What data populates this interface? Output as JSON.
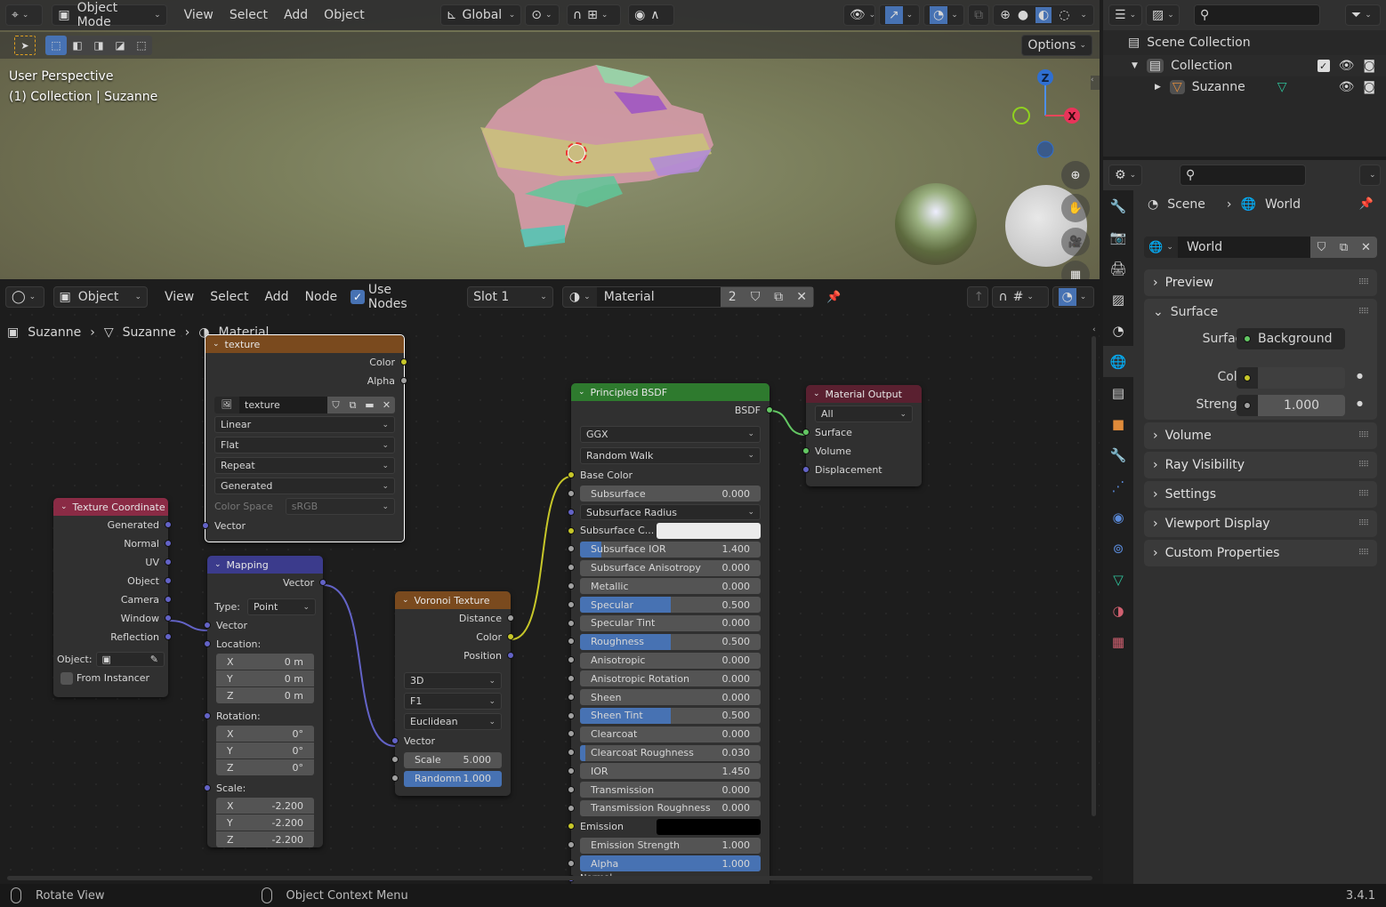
{
  "viewport": {
    "header": {
      "editor_icon": "editor-type-3d-icon",
      "mode": "Object Mode",
      "menus": [
        "View",
        "Select",
        "Add",
        "Object"
      ],
      "orientation": "Global",
      "options_label": "Options"
    },
    "overlay_text": {
      "line1": "User Perspective",
      "line2": "(1) Collection | Suzanne"
    },
    "gizmo": {
      "z": "Z",
      "x": "X"
    }
  },
  "node_editor": {
    "header": {
      "mode": "Object",
      "menus": [
        "View",
        "Select",
        "Add",
        "Node"
      ],
      "use_nodes_label": "Use Nodes",
      "use_nodes_checked": true,
      "slot": "Slot 1",
      "material_name": "Material",
      "user_count": "2"
    },
    "breadcrumb": [
      "Suzanne",
      "Suzanne",
      "Material"
    ],
    "nodes": {
      "image_texture": {
        "title": "texture",
        "outputs": [
          "Color",
          "Alpha"
        ],
        "image_name": "texture",
        "interpolation": "Linear",
        "projection": "Flat",
        "extension": "Repeat",
        "source": "Generated",
        "color_space_label": "Color Space",
        "color_space": "sRGB",
        "input": "Vector"
      },
      "texture_coordinate": {
        "title": "Texture Coordinate",
        "outputs": [
          "Generated",
          "Normal",
          "UV",
          "Object",
          "Camera",
          "Window",
          "Reflection"
        ],
        "object_label": "Object:",
        "from_instancer": "From Instancer"
      },
      "mapping": {
        "title": "Mapping",
        "output": "Vector",
        "type_label": "Type:",
        "type": "Point",
        "input_vector": "Vector",
        "location_label": "Location:",
        "location": [
          {
            "axis": "X",
            "value": "0 m"
          },
          {
            "axis": "Y",
            "value": "0 m"
          },
          {
            "axis": "Z",
            "value": "0 m"
          }
        ],
        "rotation_label": "Rotation:",
        "rotation": [
          {
            "axis": "X",
            "value": "0°"
          },
          {
            "axis": "Y",
            "value": "0°"
          },
          {
            "axis": "Z",
            "value": "0°"
          }
        ],
        "scale_label": "Scale:",
        "scale": [
          {
            "axis": "X",
            "value": "-2.200"
          },
          {
            "axis": "Y",
            "value": "-2.200"
          },
          {
            "axis": "Z",
            "value": "-2.200"
          }
        ]
      },
      "voronoi": {
        "title": "Voronoi Texture",
        "outputs": [
          "Distance",
          "Color",
          "Position"
        ],
        "dimensions": "3D",
        "feature": "F1",
        "metric": "Euclidean",
        "input_vector": "Vector",
        "scale_label": "Scale",
        "scale": "5.000",
        "random_label": "Randomn",
        "random": "1.000"
      },
      "principled": {
        "title": "Principled BSDF",
        "output": "BSDF",
        "distribution": "GGX",
        "subsurface_method": "Random Walk",
        "base_color_label": "Base Color",
        "inputs": [
          {
            "label": "Subsurface",
            "value": "0.000",
            "fill": 0
          },
          {
            "label": "Subsurface Radius",
            "type": "dropdown"
          },
          {
            "label": "Subsurface C...",
            "type": "color",
            "color": "#ebebeb"
          },
          {
            "label": "Subsurface IOR",
            "value": "1.400",
            "fill": 0.12
          },
          {
            "label": "Subsurface Anisotropy",
            "value": "0.000",
            "fill": 0
          },
          {
            "label": "Metallic",
            "value": "0.000",
            "fill": 0
          },
          {
            "label": "Specular",
            "value": "0.500",
            "fill": 0.5
          },
          {
            "label": "Specular Tint",
            "value": "0.000",
            "fill": 0
          },
          {
            "label": "Roughness",
            "value": "0.500",
            "fill": 0.5
          },
          {
            "label": "Anisotropic",
            "value": "0.000",
            "fill": 0
          },
          {
            "label": "Anisotropic Rotation",
            "value": "0.000",
            "fill": 0
          },
          {
            "label": "Sheen",
            "value": "0.000",
            "fill": 0
          },
          {
            "label": "Sheen Tint",
            "value": "0.500",
            "fill": 0.5
          },
          {
            "label": "Clearcoat",
            "value": "0.000",
            "fill": 0
          },
          {
            "label": "Clearcoat Roughness",
            "value": "0.030",
            "fill": 0.03
          },
          {
            "label": "IOR",
            "value": "1.450",
            "fill": 0
          },
          {
            "label": "Transmission",
            "value": "0.000",
            "fill": 0
          },
          {
            "label": "Transmission Roughness",
            "value": "0.000",
            "fill": 0
          },
          {
            "label": "Emission",
            "type": "color",
            "color": "#000000"
          },
          {
            "label": "Emission Strength",
            "value": "1.000",
            "fill": 0
          },
          {
            "label": "Alpha",
            "value": "1.000",
            "fill": 1
          }
        ],
        "normal_label": "Normal"
      },
      "material_output": {
        "title": "Material Output",
        "target": "All",
        "inputs": [
          "Surface",
          "Volume",
          "Displacement"
        ]
      }
    }
  },
  "outliner": {
    "scene_collection": "Scene Collection",
    "collection": "Collection",
    "object": "Suzanne"
  },
  "properties": {
    "breadcrumb": {
      "scene": "Scene",
      "world": "World"
    },
    "world_name": "World",
    "panels_top": [
      "Preview"
    ],
    "surface_panel": "Surface",
    "surface_label": "Surface",
    "surface_value": "Background",
    "color_label": "Color",
    "strength_label": "Strength",
    "strength_value": "1.000",
    "panels_bottom": [
      "Volume",
      "Ray Visibility",
      "Settings",
      "Viewport Display",
      "Custom Properties"
    ]
  },
  "status_bar": {
    "left_action": "Rotate View",
    "right_action": "Object Context Menu",
    "version": "3.4.1"
  },
  "colors": {
    "accent_blue": "#4772b3",
    "header_texture": "#7a4a1e",
    "header_shader": "#2e7a2e",
    "header_input": "#8a2b45",
    "header_vector": "#3b3b8c",
    "header_output": "#5a2030",
    "socket_color": "#c7c729",
    "socket_float": "#a1a1a1",
    "socket_vector": "#6363c7",
    "socket_shader": "#63c763"
  }
}
